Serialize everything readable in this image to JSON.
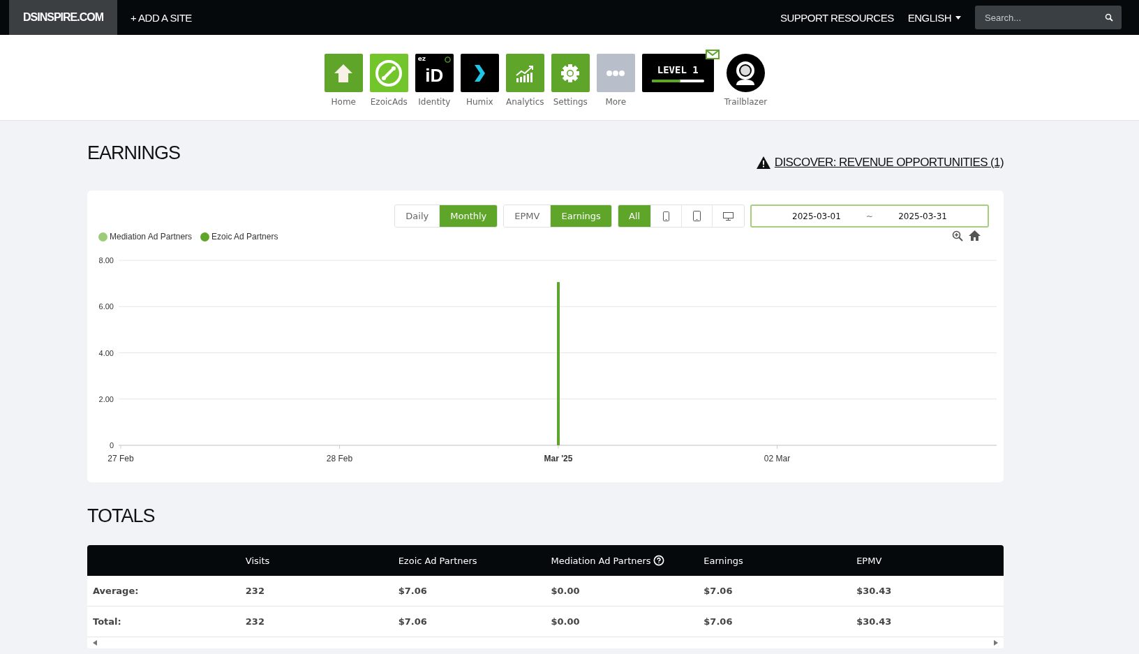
{
  "topbar": {
    "site": "DSINSPIRE.COM",
    "add_site": "+ ADD A SITE",
    "support": "SUPPORT RESOURCES",
    "language": "ENGLISH",
    "search": {
      "placeholder": "Search..."
    }
  },
  "apps": [
    {
      "kind": "home",
      "label": "Home"
    },
    {
      "kind": "ezoicads",
      "label": "EzoicAds"
    },
    {
      "kind": "identity",
      "label": "Identity",
      "badge": "ez",
      "mark": "iD"
    },
    {
      "kind": "humix",
      "label": "Humix"
    },
    {
      "kind": "analytics",
      "label": "Analytics"
    },
    {
      "kind": "settings",
      "label": "Settings"
    },
    {
      "kind": "more",
      "label": "More"
    },
    {
      "kind": "level",
      "text": "LEVEL 1",
      "level": 0.55
    },
    {
      "kind": "trailblazer",
      "label": "Trailblazer"
    }
  ],
  "earnings": {
    "title": "EARNINGS",
    "discover": "DISCOVER: REVENUE OPPORTUNITIES (1)",
    "toggle_groups": [
      {
        "options": [
          {
            "kind": "text",
            "label": "Daily",
            "selected": false
          },
          {
            "kind": "text",
            "label": "Monthly",
            "selected": true
          }
        ]
      },
      {
        "options": [
          {
            "kind": "text",
            "label": "EPMV",
            "selected": false
          },
          {
            "kind": "text",
            "label": "Earnings",
            "selected": true
          }
        ]
      },
      {
        "options": [
          {
            "kind": "text",
            "label": "All",
            "selected": true
          },
          {
            "kind": "phone",
            "selected": false
          },
          {
            "kind": "tablet",
            "selected": false
          },
          {
            "kind": "desktop",
            "selected": false
          }
        ]
      }
    ],
    "date_range": {
      "start": "2025-03-01",
      "separator": "~",
      "end": "2025-03-31"
    },
    "chart_data": {
      "type": "bar",
      "stacked": true,
      "grid": true,
      "categories": [
        "27 Feb",
        "28 Feb",
        "Mar '25",
        "02 Mar"
      ],
      "ylim": [
        0,
        8
      ],
      "yticks": [
        {
          "value": 0,
          "label": "0"
        },
        {
          "value": 2,
          "label": "2.00"
        },
        {
          "value": 4,
          "label": "4.00"
        },
        {
          "value": 6,
          "label": "6.00"
        },
        {
          "value": 8,
          "label": "8.00"
        }
      ],
      "series": [
        {
          "name": "Mediation Ad Partners",
          "color": "#9ccc7a",
          "values": [
            null,
            null,
            0,
            null
          ]
        },
        {
          "name": "Ezoic Ad Partners",
          "color": "#5ea52a",
          "values": [
            null,
            null,
            7.06,
            null
          ]
        }
      ]
    }
  },
  "totals": {
    "title": "TOTALS",
    "columns": [
      "Visits",
      "Ezoic Ad Partners",
      "Mediation Ad Partners",
      "Earnings",
      "EPMV"
    ],
    "rows": [
      {
        "label": "Average:",
        "cells": [
          "232",
          "$7.06",
          "$0.00",
          "$7.06",
          "$30.43"
        ]
      },
      {
        "label": "Total:",
        "cells": [
          "232",
          "$7.06",
          "$0.00",
          "$7.06",
          "$30.43"
        ]
      }
    ]
  }
}
